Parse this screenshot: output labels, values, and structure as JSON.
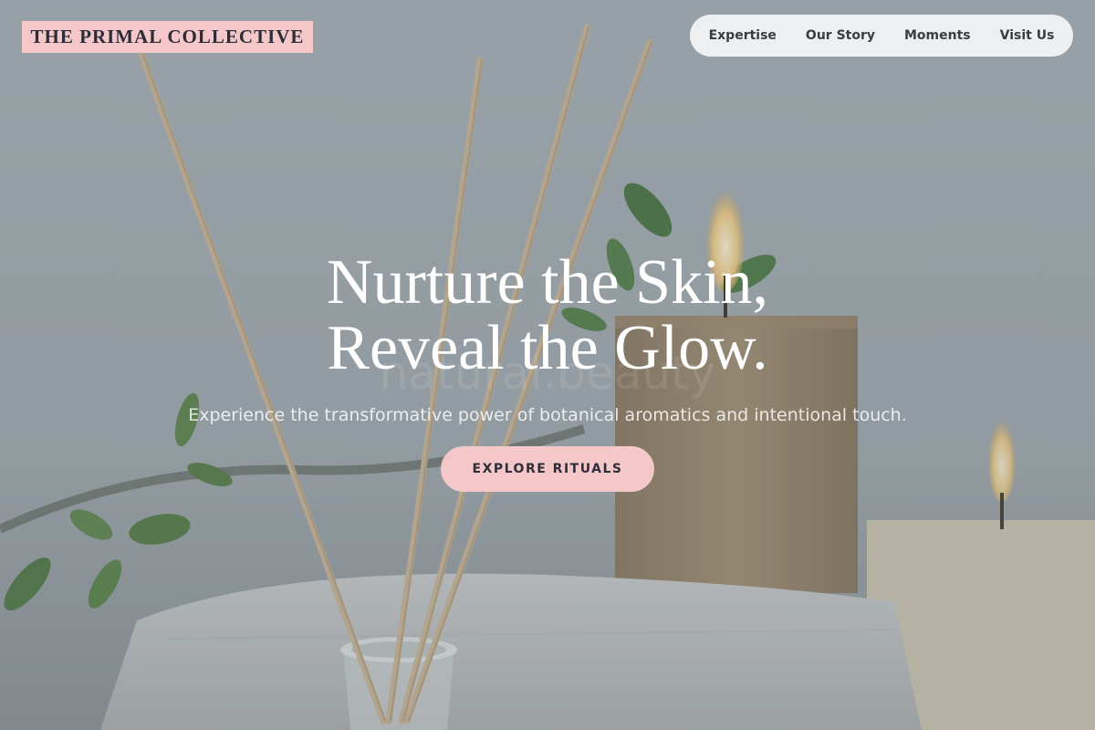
{
  "brand": {
    "name": "THE PRIMAL COLLECTIVE"
  },
  "nav": {
    "items": [
      {
        "label": "Expertise"
      },
      {
        "label": "Our Story"
      },
      {
        "label": "Moments"
      },
      {
        "label": "Visit Us"
      }
    ]
  },
  "hero": {
    "headline_line1": "Nurture the Skin,",
    "headline_line2": "Reveal the Glow.",
    "ghost_text": "natural.beauty",
    "subtitle": "Experience the transformative power of botanical aromatics and intentional touch.",
    "cta_label": "EXPLORE RITUALS"
  },
  "colors": {
    "accent_pink": "#f4c7c8",
    "nav_bg": "#eeeff0",
    "text_dark": "#2b2d3a",
    "hero_text": "#ffffff"
  }
}
